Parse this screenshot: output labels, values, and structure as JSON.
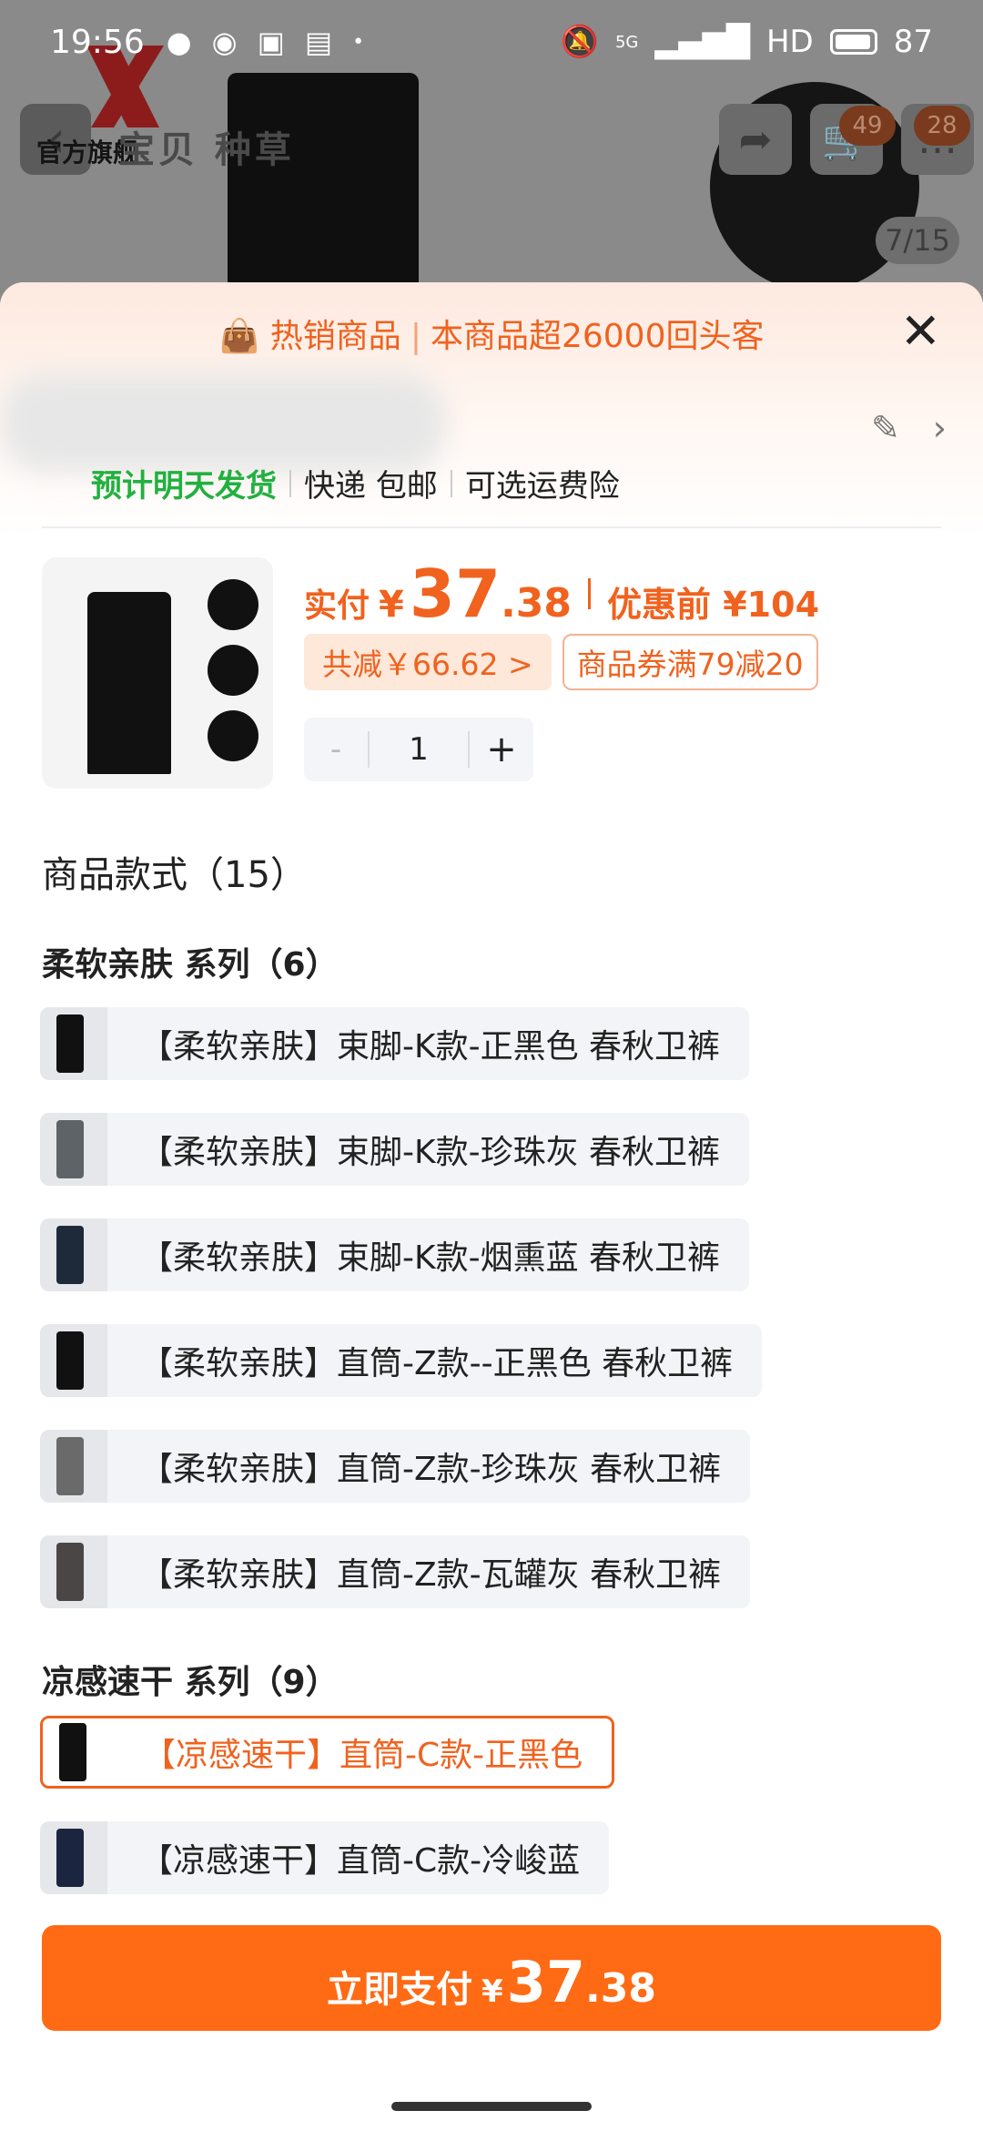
{
  "status_bar": {
    "time": "19:56",
    "network": "5G",
    "hd": "HD",
    "battery": "87"
  },
  "background": {
    "brand_text": "官方旗舰",
    "tabs": "宝贝  种草",
    "cart_badge": "49",
    "msg_badge": "28",
    "pager": "7/15"
  },
  "promo": {
    "left": "热销商品",
    "right": "本商品超26000回头客"
  },
  "shipping": {
    "eta": "预计明天发货",
    "method": "快递 包邮",
    "insurance": "可选运费险"
  },
  "price": {
    "label": "实付",
    "currency": "¥",
    "integer": "37",
    "decimal": ".38",
    "original": "优惠前 ¥104"
  },
  "chips": {
    "discount": "共减￥66.62 >",
    "coupon": "商品券满79减20"
  },
  "quantity": {
    "minus": "-",
    "value": "1",
    "plus": "+"
  },
  "styles_title": "商品款式（15）",
  "series": [
    {
      "title": "柔软亲肤 系列（6）",
      "options": [
        {
          "label": "【柔软亲肤】束脚-K款-正黑色 春秋卫裤",
          "color": "#111111"
        },
        {
          "label": "【柔软亲肤】束脚-K款-珍珠灰 春秋卫裤",
          "color": "#5d6366"
        },
        {
          "label": "【柔软亲肤】束脚-K款-烟熏蓝 春秋卫裤",
          "color": "#1e2a3a"
        },
        {
          "label": "【柔软亲肤】直筒-Z款--正黑色 春秋卫裤",
          "color": "#111111"
        },
        {
          "label": "【柔软亲肤】直筒-Z款-珍珠灰 春秋卫裤",
          "color": "#6a6a6a"
        },
        {
          "label": "【柔软亲肤】直筒-Z款-瓦罐灰 春秋卫裤",
          "color": "#4b4646"
        }
      ]
    },
    {
      "title": "凉感速干 系列（9）",
      "options": [
        {
          "label": "【凉感速干】直筒-C款-正黑色",
          "color": "#111111",
          "selected": true
        },
        {
          "label": "【凉感速干】直筒-C款-冷峻蓝",
          "color": "#1c2540"
        }
      ]
    }
  ],
  "pay_button": {
    "label": "立即支付",
    "currency": "¥",
    "integer": "37",
    "decimal": ".38"
  },
  "colors": {
    "accent": "#f0621e",
    "button": "#ff6a14",
    "green": "#22b03f"
  }
}
